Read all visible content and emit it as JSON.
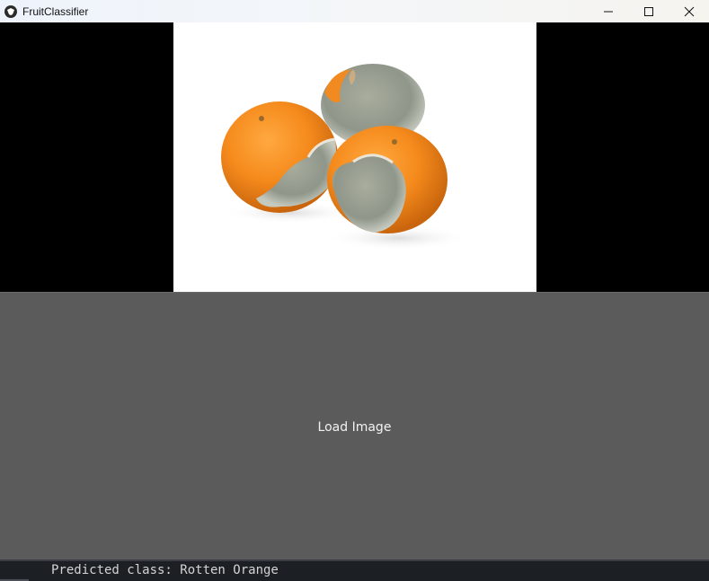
{
  "window": {
    "title": "FruitClassifier",
    "controls": {
      "minimize_icon": "minimize-icon",
      "maximize_icon": "maximize-icon",
      "close_icon": "close-icon"
    }
  },
  "image_panel": {
    "photo_subject": "three-moldy-oranges-photo"
  },
  "load_button": {
    "label": "Load Image"
  },
  "status": {
    "text": "Predicted class: Rotten Orange"
  },
  "colors": {
    "button_bg": "#5b5b5b",
    "status_bg": "#1c1f24",
    "status_text": "#d4d4d4"
  }
}
